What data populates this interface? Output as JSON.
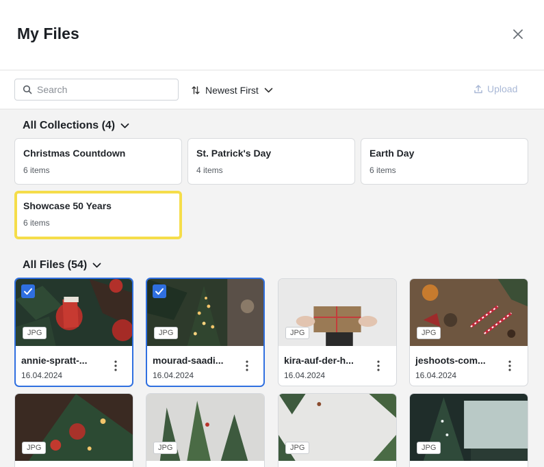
{
  "header": {
    "title": "My Files"
  },
  "toolbar": {
    "search_placeholder": "Search",
    "sort_label": "Newest First",
    "upload_label": "Upload"
  },
  "collections": {
    "heading": "All Collections (4)",
    "items": [
      {
        "name": "Christmas Countdown",
        "count": "6 items"
      },
      {
        "name": "St. Patrick's Day",
        "count": "4 items"
      },
      {
        "name": "Earth Day",
        "count": "6 items"
      },
      {
        "name": "Showcase 50 Years",
        "count": "6 items"
      }
    ]
  },
  "files": {
    "heading": "All Files (54)",
    "items": [
      {
        "name": "annie-spratt-...",
        "date": "16.04.2024",
        "type": "JPG",
        "selected": true
      },
      {
        "name": "mourad-saadi...",
        "date": "16.04.2024",
        "type": "JPG",
        "selected": true
      },
      {
        "name": "kira-auf-der-h...",
        "date": "16.04.2024",
        "type": "JPG",
        "selected": false
      },
      {
        "name": "jeshoots-com...",
        "date": "16.04.2024",
        "type": "JPG",
        "selected": false
      },
      {
        "type": "JPG"
      },
      {
        "type": "JPG"
      },
      {
        "type": "JPG"
      },
      {
        "type": "JPG"
      }
    ]
  },
  "colors": {
    "selected_border": "#2f6fe0",
    "active_collection_border": "#f5dd4a",
    "upload_disabled": "#a9b8d6"
  }
}
